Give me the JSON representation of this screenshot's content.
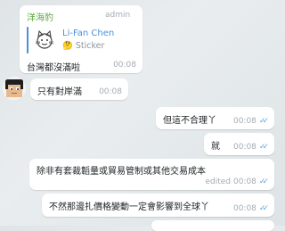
{
  "messages": [
    {
      "sender": "洋海豹",
      "role": "admin",
      "reply": {
        "name": "Li-Fan Chen",
        "preview": "🤔 Sticker"
      },
      "text": "台灣都沒滿啦",
      "time": "00:08"
    },
    {
      "text": "只有對岸滿",
      "time": "00:08"
    },
    {
      "text": "但這不合理丫",
      "time": "00:08",
      "outgoing": true
    },
    {
      "text": "就",
      "time": "00:08",
      "outgoing": true
    },
    {
      "text": "除非有套裁韜量或貿易管制或其他交易成本",
      "status": "edited",
      "time": "00:08",
      "outgoing": true
    },
    {
      "text": "不然那邊扎價格變動一定會影響到全球丫",
      "time": "00:08",
      "outgoing": true
    }
  ],
  "colors": {
    "sender_name": "#5aa83e",
    "reply_accent": "#4a90d9",
    "tick": "#5fa3de",
    "meta": "#a3acb4"
  },
  "icons": {
    "read_receipt": "double-check-icon",
    "reply_thumb": "cat-sticker-thumb"
  }
}
